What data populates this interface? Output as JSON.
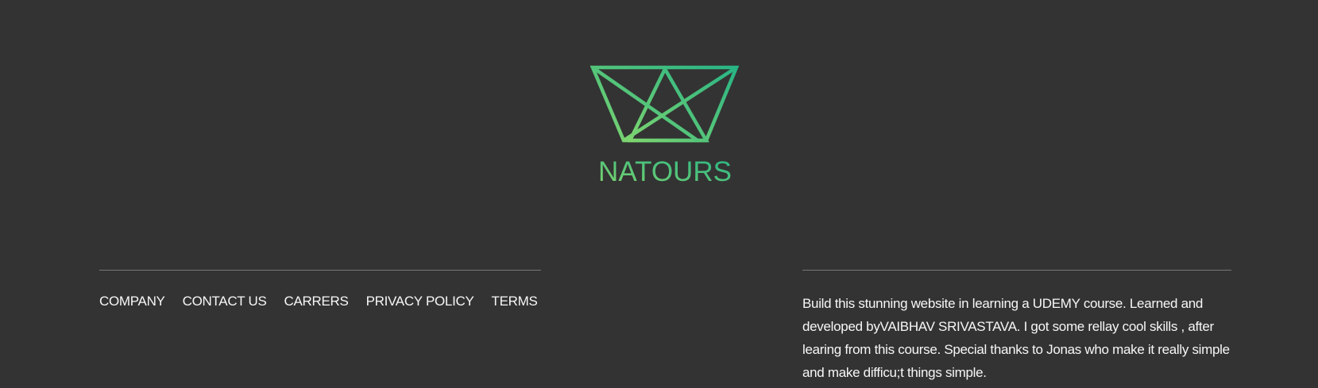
{
  "logo": {
    "icon": "crown-logo-icon",
    "text": "NATOURS",
    "gradient_start": "#7ed56f",
    "gradient_end": "#28b485"
  },
  "nav": {
    "items": [
      {
        "label": "COMPANY"
      },
      {
        "label": "CONTACT US"
      },
      {
        "label": "CARRERS"
      },
      {
        "label": "PRIVACY POLICY"
      },
      {
        "label": "TERMS"
      }
    ]
  },
  "copyright": {
    "text": "Build this stunning website in learning a UDEMY course. Learned and developed byVAIBHAV SRIVASTAVA. I got some rellay cool skills , after learing from this course. Special thanks to Jonas who make it really simple and make difficu;t things simple."
  },
  "colors": {
    "background": "#333333",
    "text": "#f7f7f7",
    "divider": "#777777"
  }
}
